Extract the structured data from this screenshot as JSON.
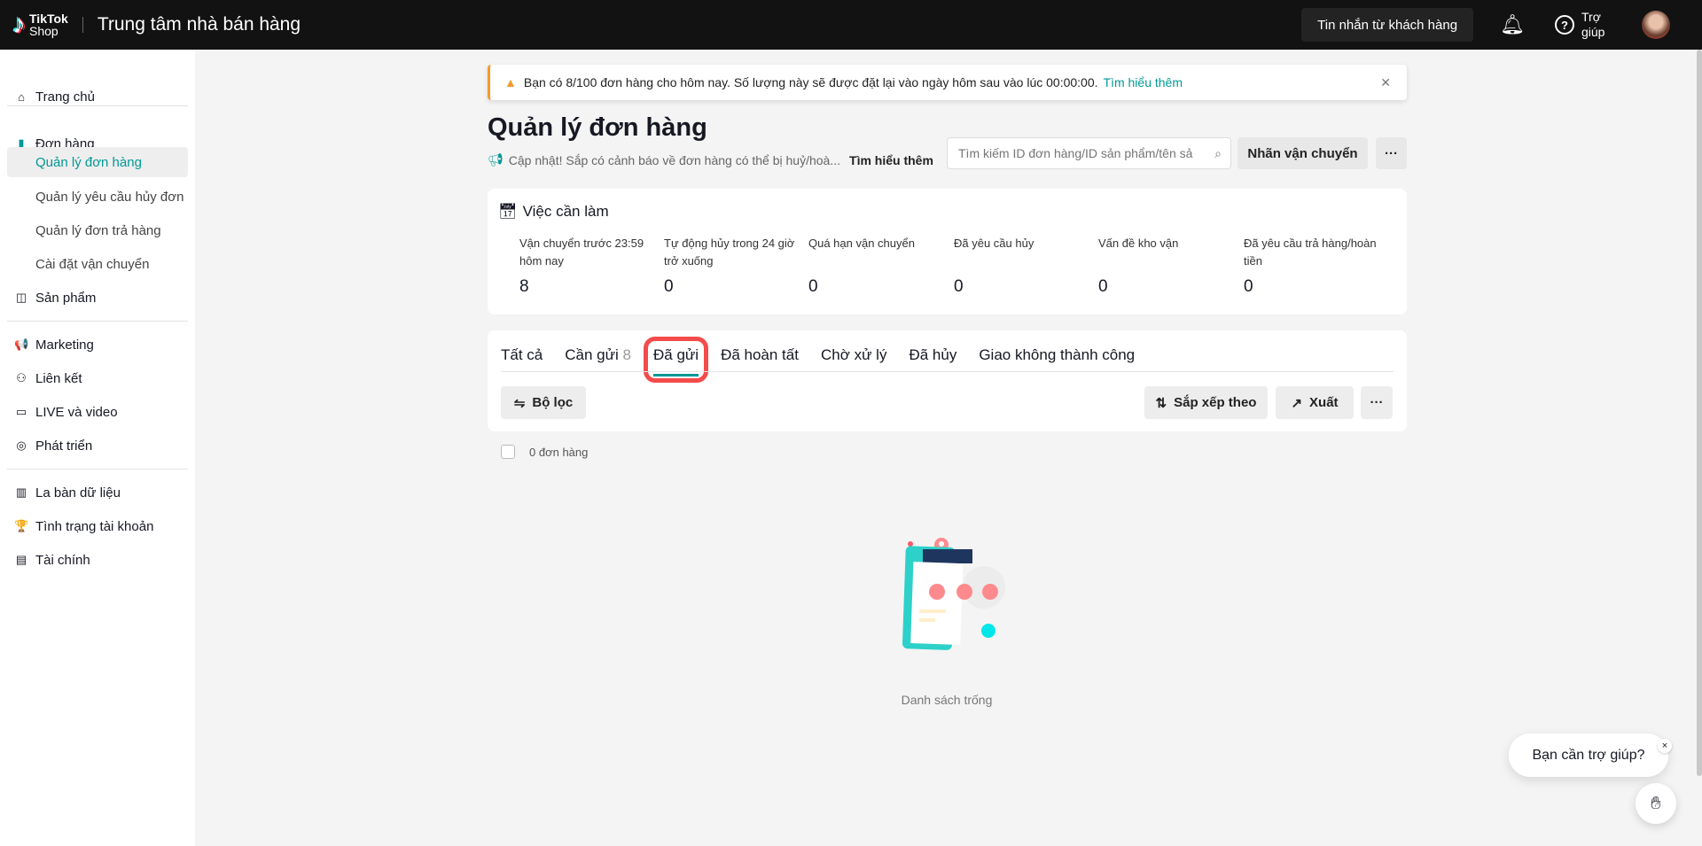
{
  "header": {
    "logo_top": "TikTok",
    "logo_bottom": "Shop",
    "title": "Trung tâm nhà bán hàng",
    "messages_button": "Tin nhắn từ khách hàng",
    "help_label": "Trợ giúp"
  },
  "sidebar": {
    "items": [
      {
        "label": "Trang chủ",
        "icon": "⌂"
      },
      {
        "label": "Đơn hàng",
        "icon": "▮"
      },
      {
        "label": "Quản lý đơn hàng"
      },
      {
        "label": "Quản lý yêu cầu hủy đơn"
      },
      {
        "label": "Quản lý đơn trả hàng"
      },
      {
        "label": "Cài đặt vận chuyển"
      },
      {
        "label": "Sản phẩm",
        "icon": "◫"
      },
      {
        "label": "Marketing",
        "icon": "📢"
      },
      {
        "label": "Liên kết",
        "icon": "⚇"
      },
      {
        "label": "LIVE và video",
        "icon": "▭"
      },
      {
        "label": "Phát triển",
        "icon": "◎"
      },
      {
        "label": "La bàn dữ liệu",
        "icon": "▥"
      },
      {
        "label": "Tình trạng tài khoản",
        "icon": "🏆"
      },
      {
        "label": "Tài chính",
        "icon": "▤"
      }
    ]
  },
  "banner": {
    "text": "Bạn có 8/100 đơn hàng cho hôm nay. Số lượng này sẽ được đặt lại vào ngày hôm sau vào lúc 00:00:00.",
    "link": "Tìm hiểu thêm"
  },
  "page": {
    "title": "Quản lý đơn hàng",
    "note": "Cập nhật! Sắp có cảnh báo về đơn hàng có thể bị huỷ/hoà...",
    "note_link": "Tìm hiểu thêm",
    "search_placeholder": "Tìm kiếm ID đơn hàng/ID sản phẩm/tên sả",
    "shipping_label_button": "Nhãn vận chuyển",
    "more": "···"
  },
  "todo": {
    "title": "Việc cần làm",
    "stats": [
      {
        "label": "Vận chuyển trước 23:59 hôm nay",
        "value": "8"
      },
      {
        "label": "Tự động hủy trong 24 giờ trở xuống",
        "value": "0"
      },
      {
        "label": "Quá hạn vận chuyển",
        "value": "0"
      },
      {
        "label": "Đã yêu cầu hủy",
        "value": "0"
      },
      {
        "label": "Vấn đề kho vận",
        "value": "0"
      },
      {
        "label": "Đã yêu cầu trả hàng/hoàn tiền",
        "value": "0"
      }
    ]
  },
  "tabs": [
    {
      "label": "Tất cả"
    },
    {
      "label": "Cần gửi",
      "count": "8"
    },
    {
      "label": "Đã gửi",
      "active": true
    },
    {
      "label": "Đã hoàn tất"
    },
    {
      "label": "Chờ xử lý"
    },
    {
      "label": "Đã hủy"
    },
    {
      "label": "Giao không thành công"
    }
  ],
  "toolbar": {
    "filter": "Bộ lọc",
    "sort": "Sắp xếp theo",
    "export": "Xuất",
    "more": "···"
  },
  "list": {
    "count": "0 đơn hàng",
    "empty": "Danh sách trống"
  },
  "help_widget": {
    "text": "Bạn cần trợ giúp?",
    "close": "×"
  },
  "colors": {
    "accent": "#009995",
    "warning": "#f49a2b",
    "highlight": "#f44b4b"
  }
}
